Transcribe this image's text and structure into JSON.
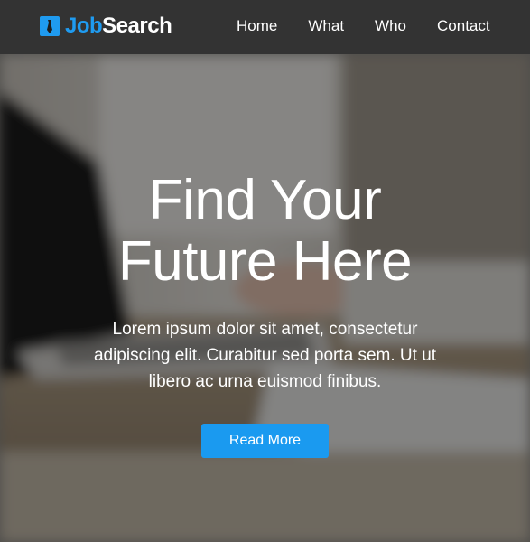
{
  "navbar": {
    "brand": {
      "part1": "Job",
      "part2": "Search",
      "icon": "tie-icon"
    },
    "links": [
      {
        "label": "Home"
      },
      {
        "label": "What"
      },
      {
        "label": "Who"
      },
      {
        "label": "Contact"
      }
    ]
  },
  "hero": {
    "title_line1": "Find Your",
    "title_line2": "Future Here",
    "text": "Lorem ipsum dolor sit amet, consectetur adipiscing elit. Curabitur sed porta sem. Ut ut libero ac urna euismod finibus.",
    "button_label": "Read More",
    "background": "blurred-laptop-photo"
  },
  "colors": {
    "accent": "#1f9bf0",
    "navbar": "#333333",
    "text": "#ffffff"
  }
}
